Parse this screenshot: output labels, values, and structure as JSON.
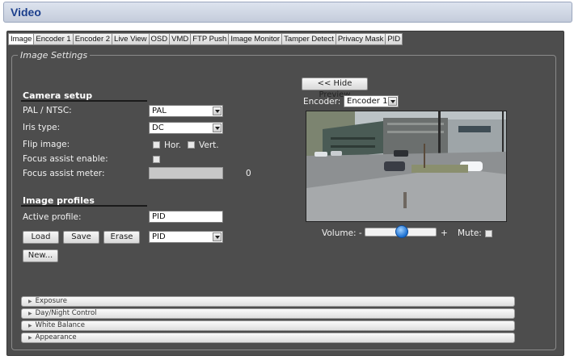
{
  "page": {
    "title": "Video"
  },
  "tabs": [
    "Image",
    "Encoder 1",
    "Encoder 2",
    "Live View",
    "OSD",
    "VMD",
    "FTP Push",
    "Image Monitor",
    "Tamper Detect",
    "Privacy Mask",
    "PID"
  ],
  "image_settings": {
    "legend": "Image Settings",
    "camera_setup": {
      "title": "Camera setup",
      "pal_ntsc": {
        "label": "PAL / NTSC:",
        "value": "PAL"
      },
      "iris_type": {
        "label": "Iris type:",
        "value": "DC"
      },
      "flip_image": {
        "label": "Flip image:",
        "hor_label": "Hor.",
        "vert_label": "Vert."
      },
      "focus_assist_enable": {
        "label": "Focus assist enable:"
      },
      "focus_assist_meter": {
        "label": "Focus assist meter:",
        "value": "0"
      }
    },
    "image_profiles": {
      "title": "Image profiles",
      "active_profile": {
        "label": "Active profile:",
        "value": "PID"
      },
      "buttons": {
        "load": "Load",
        "save": "Save",
        "erase": "Erase",
        "new": "New..."
      },
      "profile_select": "PID"
    },
    "preview": {
      "hide_button": "<< Hide Preview",
      "encoder_label": "Encoder:",
      "encoder_value": "Encoder 1",
      "volume_label": "Volume: -",
      "volume_plus": "+",
      "volume_level": 0.52,
      "mute_label": "Mute:"
    },
    "accordion": [
      "Exposure",
      "Day/Night Control",
      "White Balance",
      "Appearance"
    ]
  },
  "colors": {
    "panel_bg": "#4d4d4d",
    "title_text": "#1c3f8c",
    "slider_knob": "#1a6fd1"
  }
}
